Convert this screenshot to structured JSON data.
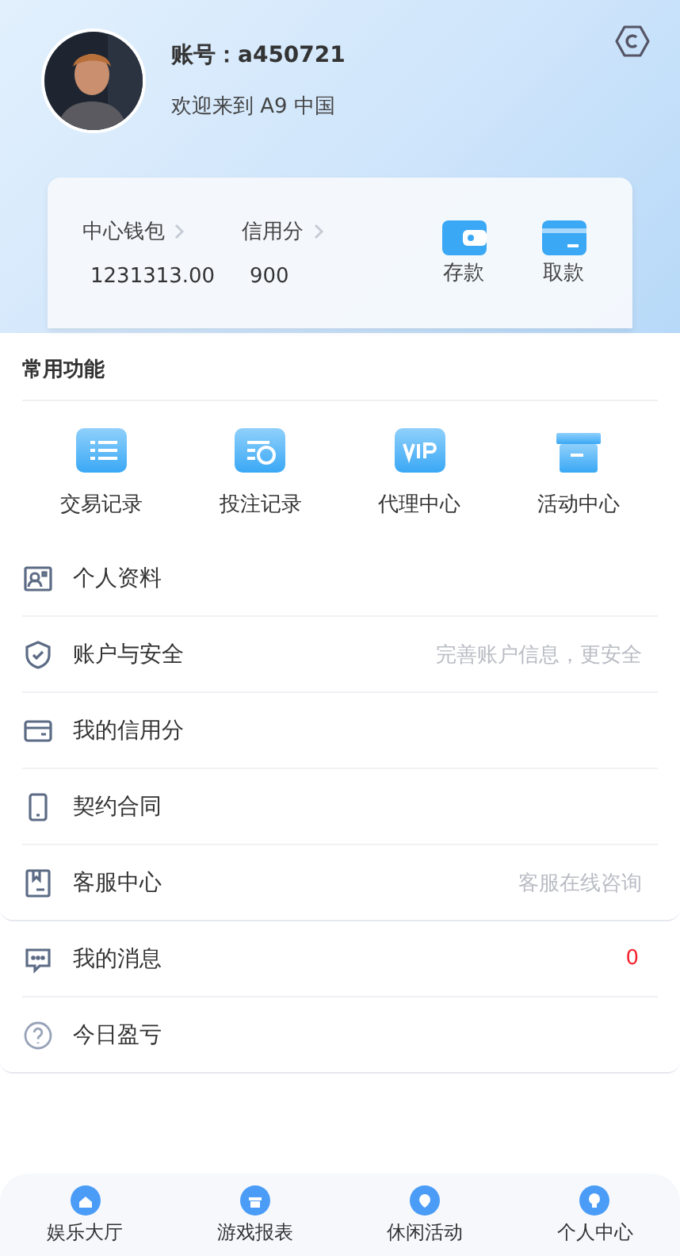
{
  "profile": {
    "account": "账号：a450721",
    "welcome": "欢迎来到 A9 中国"
  },
  "wallet": {
    "stats": [
      {
        "label": "中心钱包",
        "value": "1231313.00"
      },
      {
        "label": "信用分",
        "value": "900"
      }
    ],
    "actions": [
      {
        "label": "存款",
        "kind": "wallet"
      },
      {
        "label": "取款",
        "kind": "card"
      }
    ]
  },
  "features": {
    "title": "常用功能",
    "items": [
      {
        "label": "交易记录",
        "kind": "list"
      },
      {
        "label": "投注记录",
        "kind": "clock"
      },
      {
        "label": "代理中心",
        "kind": "vip"
      },
      {
        "label": "活动中心",
        "kind": "gift"
      }
    ]
  },
  "menu_groups": [
    [
      {
        "label": "个人资料",
        "kind": "id"
      },
      {
        "label": "账户与安全",
        "kind": "shield",
        "hint": "完善账户信息，更安全"
      },
      {
        "label": "我的信用分",
        "kind": "card"
      },
      {
        "label": "契约合同",
        "kind": "phone"
      },
      {
        "label": "客服中心",
        "kind": "service",
        "hint": "客服在线咨询"
      }
    ],
    [
      {
        "label": "我的消息",
        "kind": "chat",
        "count": "0"
      },
      {
        "label": "今日盈亏",
        "kind": "help"
      }
    ]
  ],
  "bottom_nav": [
    {
      "label": "娱乐大厅",
      "kind": "home"
    },
    {
      "label": "游戏报表",
      "kind": "gift"
    },
    {
      "label": "休闲活动",
      "kind": "dot"
    },
    {
      "label": "个人中心",
      "kind": "user"
    }
  ]
}
